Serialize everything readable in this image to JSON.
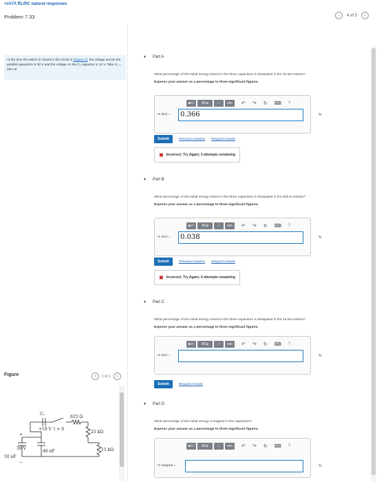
{
  "header": {
    "back_link": "<ch7A RL/RC natural responses",
    "problem_title": "Problem 7.33",
    "pager_text": "4 of 5",
    "prev_icon": "chevron-left-icon",
    "next_icon": "chevron-right-icon"
  },
  "intro": {
    "text_1": "At the time the switch is closed in the circuit in ",
    "link": "(Figure 1)",
    "text_2": ", the voltage across the parallel capacitors is 30 V and the voltage on the C₁ capacitor is 10 V. Take C₁ = 200 nF."
  },
  "figure": {
    "label": "Figure",
    "pager_text": "1 of 1",
    "circuit": {
      "c1": "C₁",
      "r1": "625 Ω",
      "v10": "+10 V",
      "minus": "−",
      "t0": "t = 0",
      "r2": "25 kΩ",
      "plus": "+",
      "v30": "30 V",
      "c10": "10 nF",
      "c40": "40 nF",
      "r3": "15 kΩ"
    }
  },
  "toolbar": {
    "sqrt": "■√□",
    "greek": "AΣφ",
    "arrows": "↓↑",
    "vec": "vec",
    "help": "?"
  },
  "parts": [
    {
      "title": "Part A",
      "question": "What percentage of the initial energy stored in the three capacitors is dissipated in the 25 kΩ resistor?",
      "instruction": "Express your answer as a percentage to three significant figures.",
      "field_label": "% diss =",
      "value": "0.366",
      "unit": "%",
      "submit": "Submit",
      "links": [
        "Previous Answers",
        "Request Answer"
      ],
      "feedback": "Incorrect; Try Again; 3 attempts remaining"
    },
    {
      "title": "Part B",
      "question": "What percentage of the initial energy stored in the three capacitors is dissipated in the 625 Ω resistor?",
      "instruction": "Express your answer as a percentage to three significant figures.",
      "field_label": "% diss =",
      "value": "0.038",
      "unit": "%",
      "submit": "Submit",
      "links": [
        "Previous Answers",
        "Request Answer"
      ],
      "feedback": "Incorrect; Try Again; 4 attempts remaining"
    },
    {
      "title": "Part C",
      "question": "What percentage of the initial energy stored in the three capacitors is dissipated in the 15 kΩ resistor?",
      "instruction": "Express your answer as a percentage to three significant figures.",
      "field_label": "% diss =",
      "value": "",
      "unit": "%",
      "submit": "Submit",
      "links": [
        "Request Answer"
      ]
    },
    {
      "title": "Part D",
      "question": "What percentage of the initial energy is trapped in the capacitors?",
      "instruction": "Express your answer as a percentage to three significant figures.",
      "field_label": "% trapped =",
      "value": "",
      "unit": "%"
    }
  ]
}
